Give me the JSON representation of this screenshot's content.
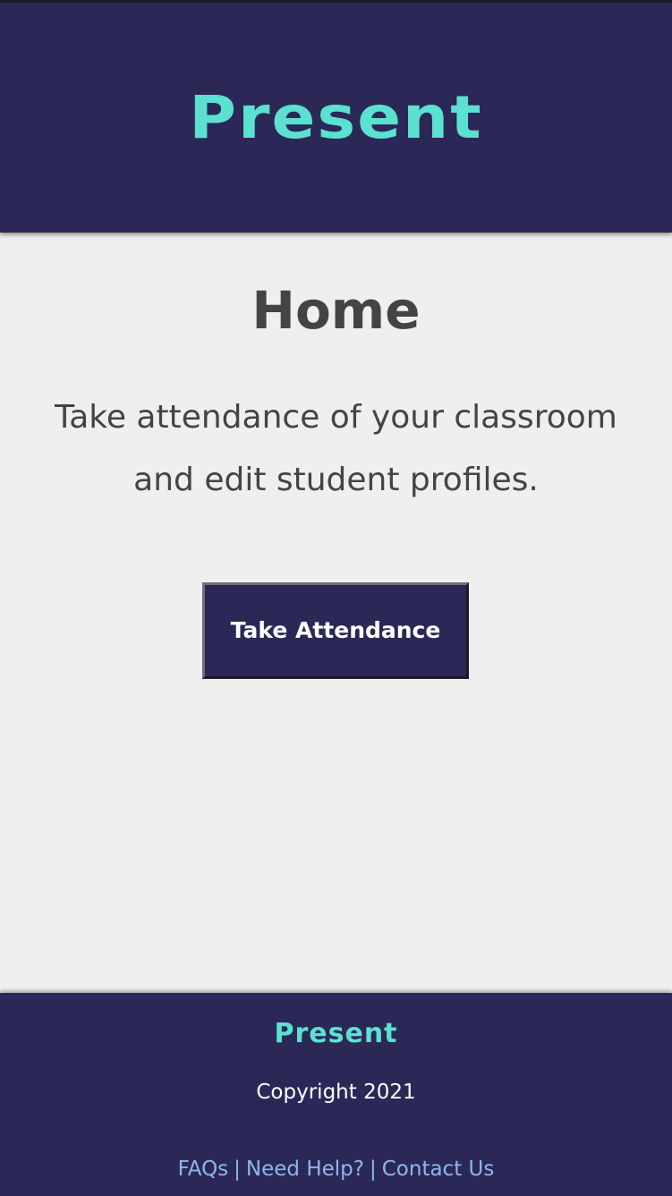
{
  "header": {
    "logo_text": "Present"
  },
  "main": {
    "title": "Home",
    "intro": "Take attendance of your classroom and edit student profiles.",
    "take_attendance_label": "Take Attendance"
  },
  "footer": {
    "logo_text": "Present",
    "copyright": "Copyright 2021",
    "links": {
      "faqs": "FAQs",
      "need_help": "Need Help?",
      "contact_us": "Contact Us",
      "separator": "|"
    }
  },
  "colors": {
    "brand_navy": "#2b2858",
    "brand_teal": "#5ce1d0",
    "background": "#efefef",
    "text_dark": "#444444",
    "link": "#8fb6ea"
  }
}
